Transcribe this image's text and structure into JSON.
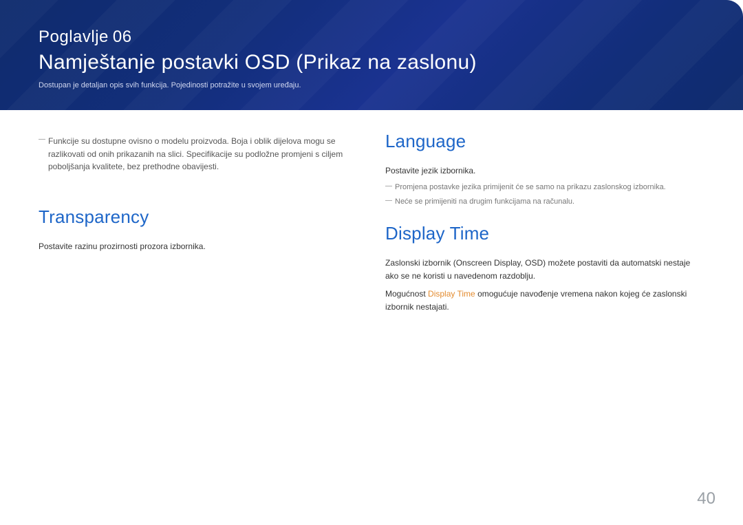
{
  "banner": {
    "chapter_label": "Poglavlje",
    "chapter_number": "06",
    "title": "Namještanje postavki OSD (Prikaz na zaslonu)",
    "subtitle": "Dostupan je detaljan opis svih funkcija. Pojedinosti potražite u svojem uređaju."
  },
  "left": {
    "top_note": "Funkcije su dostupne ovisno o modelu proizvoda. Boja i oblik dijelova mogu se razlikovati od onih prikazanih na slici. Specifikacije su podložne promjeni s ciljem poboljšanja kvalitete, bez prethodne obavijesti.",
    "transparency_heading": "Transparency",
    "transparency_body": "Postavite razinu prozirnosti prozora izbornika."
  },
  "right": {
    "language_heading": "Language",
    "language_body": "Postavite jezik izbornika.",
    "language_notes": [
      "Promjena postavke jezika primijenit će se samo na prikazu zaslonskog izbornika.",
      "Neće se primijeniti na drugim funkcijama na računalu."
    ],
    "display_time_heading": "Display Time",
    "display_time_body1": "Zaslonski izbornik (Onscreen Display, OSD) možete postaviti da automatski nestaje ako se ne koristi u navedenom razdoblju.",
    "display_time_body2_pre": "Mogućnost ",
    "display_time_body2_term": "Display Time",
    "display_time_body2_post": " omogućuje navođenje vremena nakon kojeg će zaslonski izbornik nestajati."
  },
  "page_number": "40"
}
